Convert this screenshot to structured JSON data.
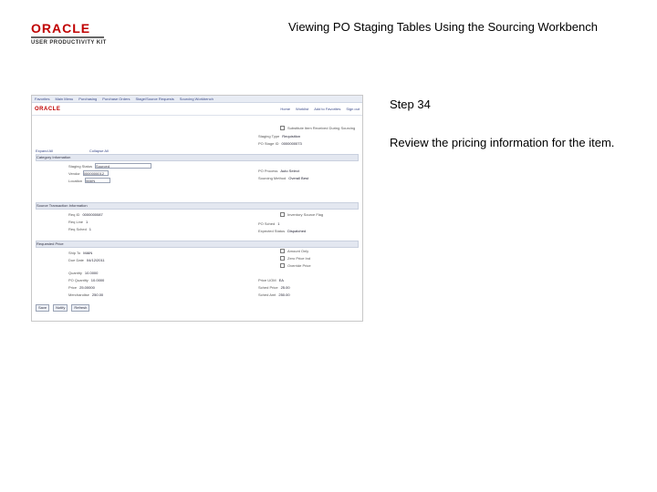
{
  "header": {
    "logo_text": "ORACLE",
    "logo_subtext": "USER PRODUCTIVITY KIT",
    "title": "Viewing PO Staging Tables Using the Sourcing Workbench"
  },
  "step": {
    "label": "Step 34",
    "instruction": "Review the pricing information for the item."
  },
  "screenshot": {
    "app_logo": "ORACLE",
    "nav_items": [
      "Favorites",
      "Main Menu",
      "Purchasing",
      "Purchase Orders",
      "Stage/Source Requests",
      "Sourcing Workbench"
    ],
    "header_links": [
      "Home",
      "Worklist",
      "Add to Favorites",
      "Sign out"
    ],
    "sections": [
      "Category Information",
      "Source Transaction Information",
      "Requested Price"
    ],
    "buttons": [
      "Save",
      "Notify",
      "Refresh"
    ],
    "checkbox_label": "Substitute Item Received During Sourcing",
    "labels": {
      "expand_all": "Expand All",
      "collapse_all": "Collapse All",
      "staging_status": "Staging Status",
      "vendor": "Vendor",
      "location": "Location",
      "req_id": "Req ID",
      "req_line": "Req Line",
      "req_sched": "Req Sched",
      "ship_to": "Ship To",
      "due_date": "Due Date",
      "quantity": "Quantity",
      "po_quantity": "PO Quantity",
      "price": "Price",
      "merchandise": "Merchandise",
      "staging_type": "Staging Type",
      "po_stage_id": "PO Stage ID",
      "po_process": "PO Process",
      "sourcing_method": "Sourcing Method",
      "inventory_source": "Inventory Source Flag",
      "po_sched": "PO Sched",
      "expected_status": "Expected Status",
      "amount_only": "Amount Only",
      "zero_price": "Zero Price Ind",
      "override_price": "Override Price",
      "price_uom": "Price UOM",
      "schedule_price": "Sched Price",
      "schedule_amt": "Sched Amt"
    },
    "values": {
      "staging_status": "Sourced",
      "vendor": "0000000012",
      "location": "MAIN",
      "req_id": "0000000087",
      "req_line": "1",
      "req_sched": "1",
      "ship_to": "MAIN",
      "due_date": "04/12/2011",
      "quantity": "10.0000",
      "po_quantity": "10.0000",
      "price": "25.00000",
      "merchandise": "250.00",
      "staging_type": "Requisition",
      "po_stage_id": "0000000073",
      "po_process": "Auto Select",
      "sourcing_method": "Overall Best",
      "po_sched": "1",
      "expected_status": "Dispatched",
      "price_uom": "EA",
      "schedule_price": "25.00",
      "schedule_amt": "250.00"
    }
  }
}
